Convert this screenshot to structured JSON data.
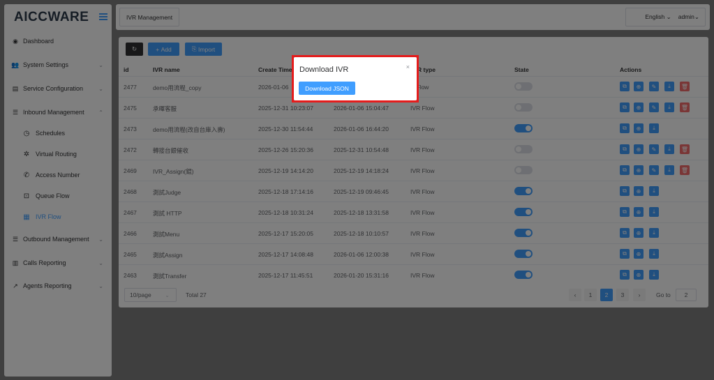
{
  "app": {
    "logo_text": "AICCWARE"
  },
  "sidebar": {
    "items": [
      {
        "label": "Dashboard",
        "icon": "dashboard-icon"
      },
      {
        "label": "System Settings",
        "icon": "users-icon"
      },
      {
        "label": "Service Configuration",
        "icon": "config-icon"
      },
      {
        "label": "Inbound Management",
        "icon": "list-icon"
      },
      {
        "label": "Outbound Management",
        "icon": "list-icon"
      },
      {
        "label": "Calls Reporting",
        "icon": "bar-chart-icon"
      },
      {
        "label": "Agents Reporting",
        "icon": "line-chart-icon"
      }
    ],
    "subitems": [
      {
        "label": "Schedules",
        "icon": "clock-icon"
      },
      {
        "label": "Virtual Routing",
        "icon": "gear-icon"
      },
      {
        "label": "Access Number",
        "icon": "phone-icon"
      },
      {
        "label": "Queue Flow",
        "icon": "queue-icon"
      },
      {
        "label": "IVR Flow",
        "icon": "grid-icon"
      }
    ]
  },
  "header": {
    "tab_label": "IVR Management",
    "language": "English",
    "user": "admin"
  },
  "toolbar": {
    "add_label": "Add",
    "import_label": "Import"
  },
  "table": {
    "columns": [
      "id",
      "IVR name",
      "Create Time",
      "",
      "R type",
      "State",
      "Actions"
    ],
    "rows": [
      {
        "id": "2477",
        "name": "demo用流程_copy",
        "created": "2026-01-06",
        "updated": "",
        "type": "R Flow",
        "state": false,
        "actions": 5
      },
      {
        "id": "2475",
        "name": "承暉客服",
        "created": "2025-12-31 10:23:07",
        "updated": "2026-01-06 15:04:47",
        "type": "IVR Flow",
        "state": false,
        "actions": 5
      },
      {
        "id": "2473",
        "name": "demo用流程(改自台庫入壽)",
        "created": "2025-12-30 11:54:44",
        "updated": "2026-01-06 16:44:20",
        "type": "IVR Flow",
        "state": true,
        "actions": 3
      },
      {
        "id": "2472",
        "name": "轉接台銀催收",
        "created": "2025-12-26 15:20:36",
        "updated": "2025-12-31 10:54:48",
        "type": "IVR Flow",
        "state": false,
        "actions": 5
      },
      {
        "id": "2469",
        "name": "IVR_Assign(錕)",
        "created": "2025-12-19 14:14:20",
        "updated": "2025-12-19 14:18:24",
        "type": "IVR Flow",
        "state": false,
        "actions": 5
      },
      {
        "id": "2468",
        "name": "測試Judge",
        "created": "2025-12-18 17:14:16",
        "updated": "2025-12-19 09:46:45",
        "type": "IVR Flow",
        "state": true,
        "actions": 3
      },
      {
        "id": "2467",
        "name": "測試 HTTP",
        "created": "2025-12-18 10:31:24",
        "updated": "2025-12-18 13:31:58",
        "type": "IVR Flow",
        "state": true,
        "actions": 3
      },
      {
        "id": "2466",
        "name": "測試Menu",
        "created": "2025-12-17 15:20:05",
        "updated": "2025-12-18 10:10:57",
        "type": "IVR Flow",
        "state": true,
        "actions": 3
      },
      {
        "id": "2465",
        "name": "測試Assign",
        "created": "2025-12-17 14:08:48",
        "updated": "2026-01-06 12:00:38",
        "type": "IVR Flow",
        "state": true,
        "actions": 3
      },
      {
        "id": "2463",
        "name": "測試Transfer",
        "created": "2025-12-17 11:45:51",
        "updated": "2026-01-20 15:31:16",
        "type": "IVR Flow",
        "state": true,
        "actions": 3
      }
    ]
  },
  "pagination": {
    "page_size": "10/page",
    "total": "Total 27",
    "pages": [
      "1",
      "2",
      "3"
    ],
    "current": "2",
    "goto_label": "Go to",
    "goto_value": "2"
  },
  "dialog": {
    "title": "Download IVR",
    "button_label": "Download JSON",
    "close_glyph": "×"
  },
  "colors": {
    "accent": "#409eff",
    "danger": "#f56c6c",
    "highlight_frame": "#e51c1c"
  }
}
